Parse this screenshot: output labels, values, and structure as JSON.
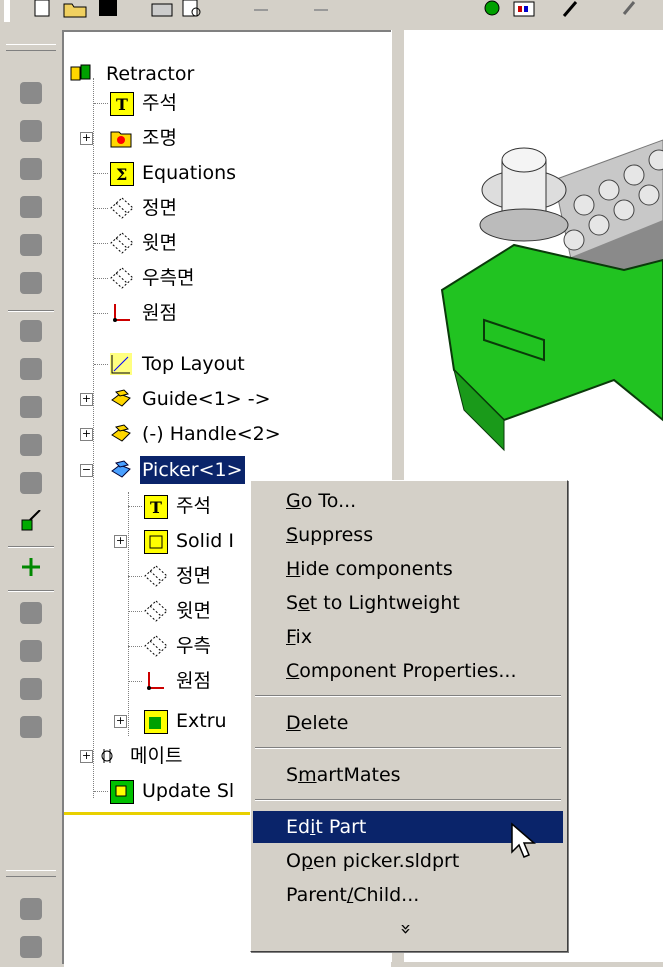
{
  "tree": {
    "root": "Retractor",
    "items": [
      {
        "label": "주석",
        "icon": "annotations-icon"
      },
      {
        "label": "조명",
        "icon": "lighting-folder-icon"
      },
      {
        "label": "Equations",
        "icon": "equations-icon"
      },
      {
        "label": "정면",
        "icon": "plane-icon"
      },
      {
        "label": "윗면",
        "icon": "plane-icon"
      },
      {
        "label": "우측면",
        "icon": "plane-icon"
      },
      {
        "label": "원점",
        "icon": "origin-icon"
      },
      {
        "label": "Top Layout",
        "icon": "sketch-icon"
      },
      {
        "label": "Guide<1> ->",
        "icon": "component-icon"
      },
      {
        "label": "(-) Handle<2>",
        "icon": "component-icon"
      },
      {
        "label": "Picker<1>",
        "icon": "component-icon"
      },
      {
        "label": "주석",
        "icon": "annotations-icon"
      },
      {
        "label": "Solid I",
        "icon": "solid-bodies-icon"
      },
      {
        "label": "정면",
        "icon": "plane-icon"
      },
      {
        "label": "윗면",
        "icon": "plane-icon"
      },
      {
        "label": "우측",
        "icon": "plane-icon"
      },
      {
        "label": "원점",
        "icon": "origin-icon"
      },
      {
        "label": "Extru",
        "icon": "extrude-icon"
      },
      {
        "label": "메이트",
        "icon": "mates-icon"
      },
      {
        "label": "Update Sl",
        "icon": "update-icon"
      }
    ]
  },
  "context_menu": {
    "items": [
      {
        "pre": "",
        "ul": "G",
        "post": "o To..."
      },
      {
        "pre": "",
        "ul": "S",
        "post": "uppress"
      },
      {
        "pre": "",
        "ul": "H",
        "post": "ide components"
      },
      {
        "pre": "S",
        "ul": "e",
        "post": "t to Lightweight"
      },
      {
        "pre": "",
        "ul": "F",
        "post": "ix"
      },
      {
        "pre": "",
        "ul": "C",
        "post": "omponent Properties..."
      },
      {
        "pre": "",
        "ul": "D",
        "post": "elete"
      },
      {
        "pre": "S",
        "ul": "m",
        "post": "artMates"
      },
      {
        "pre": "Ed",
        "ul": "i",
        "post": "t Part"
      },
      {
        "pre": "O",
        "ul": "p",
        "post": "en picker.sldprt"
      },
      {
        "pre": "Parent",
        "ul": "/",
        "post": "Child..."
      }
    ],
    "more": "»"
  },
  "colors": {
    "selection": "#0a246a",
    "part_green": "#21c321",
    "tree_bottom_border": "#e8d000"
  }
}
